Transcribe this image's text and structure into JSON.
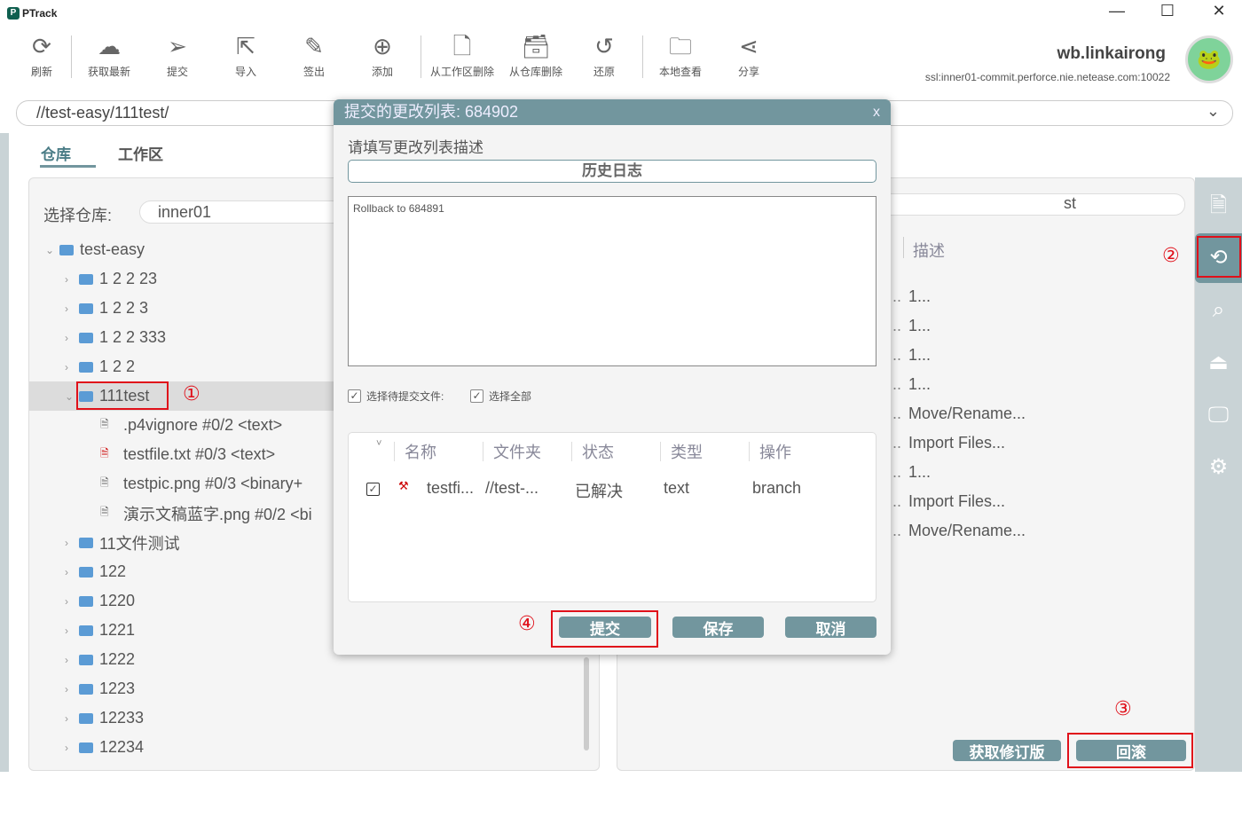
{
  "app": {
    "name": "PTrack",
    "logo_glyph": "P"
  },
  "window_controls": {
    "minimize": "—",
    "maximize": "☐",
    "close": "✕"
  },
  "toolbar": [
    {
      "label": "刷新",
      "icon": "⟳"
    },
    {
      "label": "获取最新",
      "icon": "☁"
    },
    {
      "label": "提交",
      "icon": "➢"
    },
    {
      "label": "导入",
      "icon": "⇱"
    },
    {
      "label": "签出",
      "icon": "✎"
    },
    {
      "label": "添加",
      "icon": "⊕"
    },
    {
      "label": "从工作区删除",
      "icon": "🗋"
    },
    {
      "label": "从仓库删除",
      "icon": "🗃"
    },
    {
      "label": "还原",
      "icon": "↺"
    },
    {
      "label": "本地查看",
      "icon": "🗀"
    },
    {
      "label": "分享",
      "icon": "⋖"
    }
  ],
  "user": {
    "name": "wb.linkairong",
    "server": "ssl:inner01-commit.perforce.nie.netease.com:10022"
  },
  "path": {
    "value": "//test-easy/111test/",
    "chevron": "⌄"
  },
  "tabs": [
    {
      "label": "仓库",
      "active": true
    },
    {
      "label": "工作区",
      "active": false
    }
  ],
  "left": {
    "repo_label": "选择仓库:",
    "repo_value": "inner01",
    "tree": [
      {
        "label": "test-easy",
        "level": 0,
        "type": "folder",
        "expanded": true
      },
      {
        "label": "1 2 2 23",
        "level": 1,
        "type": "folder"
      },
      {
        "label": "1 2 2 3",
        "level": 1,
        "type": "folder"
      },
      {
        "label": "1 2 2 333",
        "level": 1,
        "type": "folder"
      },
      {
        "label": "1 2 2",
        "level": 1,
        "type": "folder"
      },
      {
        "label": "111test",
        "level": 1,
        "type": "folder",
        "expanded": true,
        "selected": true
      },
      {
        "label": ".p4vignore  #0/2 <text>",
        "level": 2,
        "type": "file"
      },
      {
        "label": "testfile.txt  #0/3 <text>",
        "level": 2,
        "type": "file",
        "modified": true
      },
      {
        "label": "testpic.png  #0/3 <binary+",
        "level": 2,
        "type": "file"
      },
      {
        "label": "演示文稿蓝字.png  #0/2 <bi",
        "level": 2,
        "type": "file"
      },
      {
        "label": "11文件测试",
        "level": 1,
        "type": "folder"
      },
      {
        "label": "122",
        "level": 1,
        "type": "folder"
      },
      {
        "label": "1220",
        "level": 1,
        "type": "folder"
      },
      {
        "label": "1221",
        "level": 1,
        "type": "folder"
      },
      {
        "label": "1222",
        "level": 1,
        "type": "folder"
      },
      {
        "label": "1223",
        "level": 1,
        "type": "folder"
      },
      {
        "label": "12233",
        "level": 1,
        "type": "folder"
      },
      {
        "label": "12234",
        "level": 1,
        "type": "folder"
      }
    ]
  },
  "right": {
    "search_value": "st",
    "desc_header": "描述",
    "rows": [
      "1...",
      "1...",
      "1...",
      "1...",
      "Move/Rename...",
      "Import Files...",
      "1...",
      "Import Files...",
      "Move/Rename..."
    ],
    "get_revision": "获取修订版",
    "rollback": "回滚"
  },
  "sidebar": [
    {
      "icon": "document-icon",
      "glyph": "🗎"
    },
    {
      "icon": "history-icon",
      "glyph": "⟲",
      "active": true
    },
    {
      "icon": "search-icon",
      "glyph": "⌕"
    },
    {
      "icon": "shelf-icon",
      "glyph": "⏏"
    },
    {
      "icon": "monitor-icon",
      "glyph": "🖵"
    },
    {
      "icon": "gear-icon",
      "glyph": "⚙"
    }
  ],
  "markers": {
    "m1": "①",
    "m2": "②",
    "m3": "③",
    "m4": "④"
  },
  "dialog": {
    "title": "提交的更改列表:  684902",
    "close": "x",
    "prompt": "请填写更改列表描述",
    "history_button": "历史日志",
    "description": "Rollback to 684891",
    "select_pending": "选择待提交文件:",
    "select_all": "选择全部",
    "columns": [
      "名称",
      "文件夹",
      "状态",
      "类型",
      "操作"
    ],
    "files": [
      {
        "name": "testfi...",
        "folder": "//test-...",
        "status": "已解决",
        "type": "text",
        "action": "branch",
        "checked": true
      }
    ],
    "submit": "提交",
    "save": "保存",
    "cancel": "取消"
  },
  "colors": {
    "accent": "#72969e",
    "highlight": "#e0101a",
    "sidebar": "#c9d3d6"
  }
}
